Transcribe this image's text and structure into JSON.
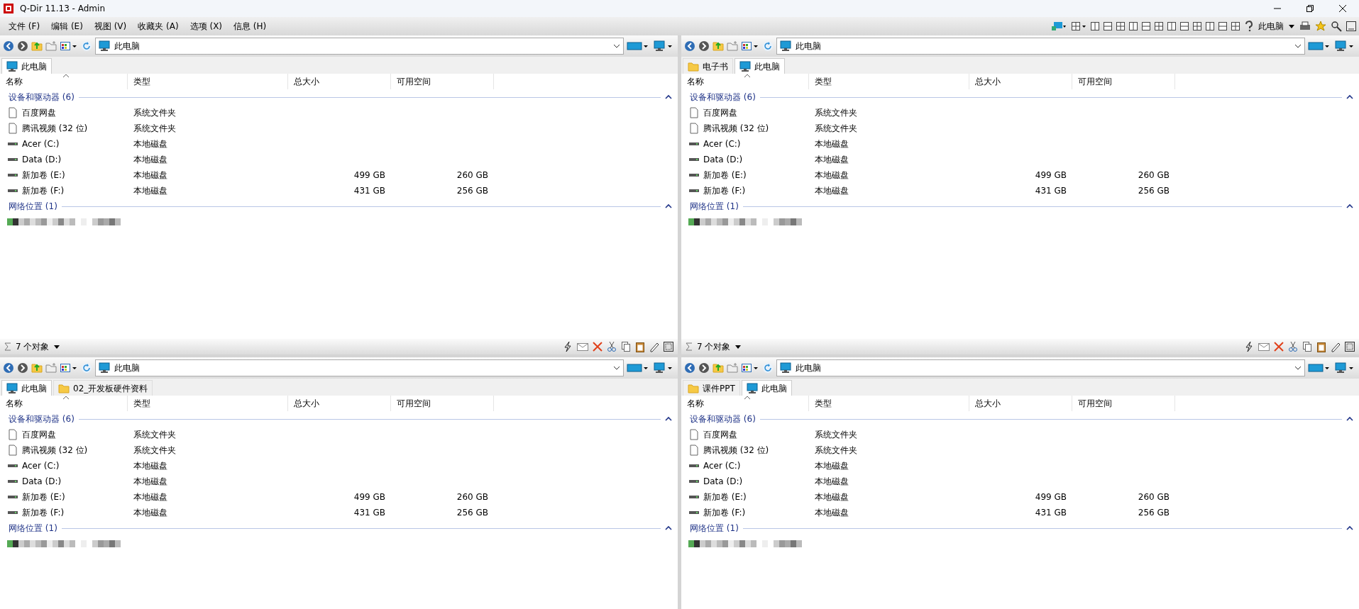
{
  "window": {
    "title": "Q-Dir 11.13 - Admin"
  },
  "menu": [
    "文件 (F)",
    "编辑 (E)",
    "视图 (V)",
    "收藏夹 (A)",
    "选项 (X)",
    "信息 (H)"
  ],
  "top_toolbar": {
    "location": "此电脑"
  },
  "panes": [
    {
      "tabs": [
        {
          "label": "此电脑",
          "kind": "computer",
          "selected": true
        }
      ],
      "address": "此电脑",
      "columns": [
        "名称",
        "类型",
        "总大小",
        "可用空间"
      ],
      "groups": [
        {
          "title": "设备和驱动器 (6)",
          "items": [
            {
              "kind": "file",
              "name": "百度网盘",
              "type": "系统文件夹"
            },
            {
              "kind": "file",
              "name": "腾讯视频 (32 位)",
              "type": "系统文件夹"
            },
            {
              "kind": "drive",
              "name": "Acer (C:)",
              "type": "本地磁盘"
            },
            {
              "kind": "drive",
              "name": "Data (D:)",
              "type": "本地磁盘"
            },
            {
              "kind": "drive",
              "name": "新加卷 (E:)",
              "type": "本地磁盘",
              "total": "499 GB",
              "free": "260 GB"
            },
            {
              "kind": "drive",
              "name": "新加卷 (F:)",
              "type": "本地磁盘",
              "total": "431 GB",
              "free": "256 GB"
            }
          ]
        },
        {
          "title": "网络位置 (1)",
          "items": [
            {
              "kind": "redacted"
            }
          ]
        }
      ],
      "status": "7 个对象"
    },
    {
      "tabs": [
        {
          "label": "电子书",
          "kind": "folder",
          "selected": false
        },
        {
          "label": "此电脑",
          "kind": "computer",
          "selected": true
        }
      ],
      "address": "此电脑",
      "columns": [
        "名称",
        "类型",
        "总大小",
        "可用空间"
      ],
      "groups": [
        {
          "title": "设备和驱动器 (6)",
          "items": [
            {
              "kind": "file",
              "name": "百度网盘",
              "type": "系统文件夹"
            },
            {
              "kind": "file",
              "name": "腾讯视频 (32 位)",
              "type": "系统文件夹"
            },
            {
              "kind": "drive",
              "name": "Acer (C:)",
              "type": "本地磁盘"
            },
            {
              "kind": "drive",
              "name": "Data (D:)",
              "type": "本地磁盘"
            },
            {
              "kind": "drive",
              "name": "新加卷 (E:)",
              "type": "本地磁盘",
              "total": "499 GB",
              "free": "260 GB"
            },
            {
              "kind": "drive",
              "name": "新加卷 (F:)",
              "type": "本地磁盘",
              "total": "431 GB",
              "free": "256 GB"
            }
          ]
        },
        {
          "title": "网络位置 (1)",
          "items": [
            {
              "kind": "redacted"
            }
          ]
        }
      ],
      "status": "7 个对象"
    },
    {
      "tabs": [
        {
          "label": "此电脑",
          "kind": "computer",
          "selected": true
        },
        {
          "label": "02_开发板硬件资料",
          "kind": "folder",
          "selected": false
        }
      ],
      "address": "此电脑",
      "columns": [
        "名称",
        "类型",
        "总大小",
        "可用空间"
      ],
      "groups": [
        {
          "title": "设备和驱动器 (6)",
          "items": [
            {
              "kind": "file",
              "name": "百度网盘",
              "type": "系统文件夹"
            },
            {
              "kind": "file",
              "name": "腾讯视频 (32 位)",
              "type": "系统文件夹"
            },
            {
              "kind": "drive",
              "name": "Acer (C:)",
              "type": "本地磁盘"
            },
            {
              "kind": "drive",
              "name": "Data (D:)",
              "type": "本地磁盘"
            },
            {
              "kind": "drive",
              "name": "新加卷 (E:)",
              "type": "本地磁盘",
              "total": "499 GB",
              "free": "260 GB"
            },
            {
              "kind": "drive",
              "name": "新加卷 (F:)",
              "type": "本地磁盘",
              "total": "431 GB",
              "free": "256 GB"
            }
          ]
        },
        {
          "title": "网络位置 (1)",
          "items": [
            {
              "kind": "redacted"
            }
          ]
        }
      ]
    },
    {
      "tabs": [
        {
          "label": "课件PPT",
          "kind": "folder",
          "selected": false
        },
        {
          "label": "此电脑",
          "kind": "computer",
          "selected": true
        }
      ],
      "address": "此电脑",
      "columns": [
        "名称",
        "类型",
        "总大小",
        "可用空间"
      ],
      "groups": [
        {
          "title": "设备和驱动器 (6)",
          "items": [
            {
              "kind": "file",
              "name": "百度网盘",
              "type": "系统文件夹"
            },
            {
              "kind": "file",
              "name": "腾讯视频 (32 位)",
              "type": "系统文件夹"
            },
            {
              "kind": "drive",
              "name": "Acer (C:)",
              "type": "本地磁盘"
            },
            {
              "kind": "drive",
              "name": "Data (D:)",
              "type": "本地磁盘"
            },
            {
              "kind": "drive",
              "name": "新加卷 (E:)",
              "type": "本地磁盘",
              "total": "499 GB",
              "free": "260 GB"
            },
            {
              "kind": "drive",
              "name": "新加卷 (F:)",
              "type": "本地磁盘",
              "total": "431 GB",
              "free": "256 GB"
            }
          ]
        },
        {
          "title": "网络位置 (1)",
          "items": [
            {
              "kind": "redacted"
            }
          ]
        }
      ]
    }
  ]
}
